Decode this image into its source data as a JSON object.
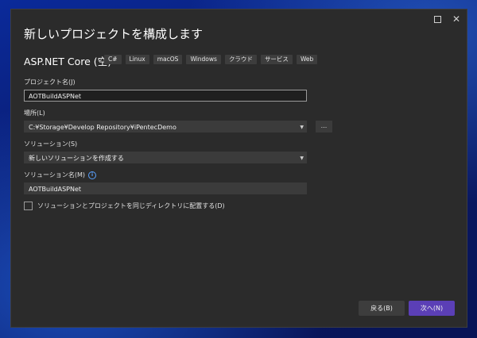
{
  "dialog": {
    "title": "新しいプロジェクトを構成します",
    "template_name": "ASP.NET Core (空)",
    "tags": [
      "C#",
      "Linux",
      "macOS",
      "Windows",
      "クラウド",
      "サービス",
      "Web"
    ]
  },
  "fields": {
    "project_name_label": "プロジェクト名(J)",
    "project_name_value": "AOTBuildASPNet",
    "location_label": "場所(L)",
    "location_value": "C:¥Storage¥Develop Repository¥iPentecDemo",
    "browse_label": "...",
    "solution_label": "ソリューション(S)",
    "solution_value": "新しいソリューションを作成する",
    "solution_name_label": "ソリューション名(M)",
    "solution_name_value": "AOTBuildASPNet",
    "same_dir_label": "ソリューションとプロジェクトを同じディレクトリに配置する(D)"
  },
  "buttons": {
    "back": "戻る(B)",
    "next": "次へ(N)"
  },
  "colors": {
    "dialog_bg": "#2b2b2b",
    "accent": "#5b3fb6",
    "info": "#5aa2ff"
  }
}
